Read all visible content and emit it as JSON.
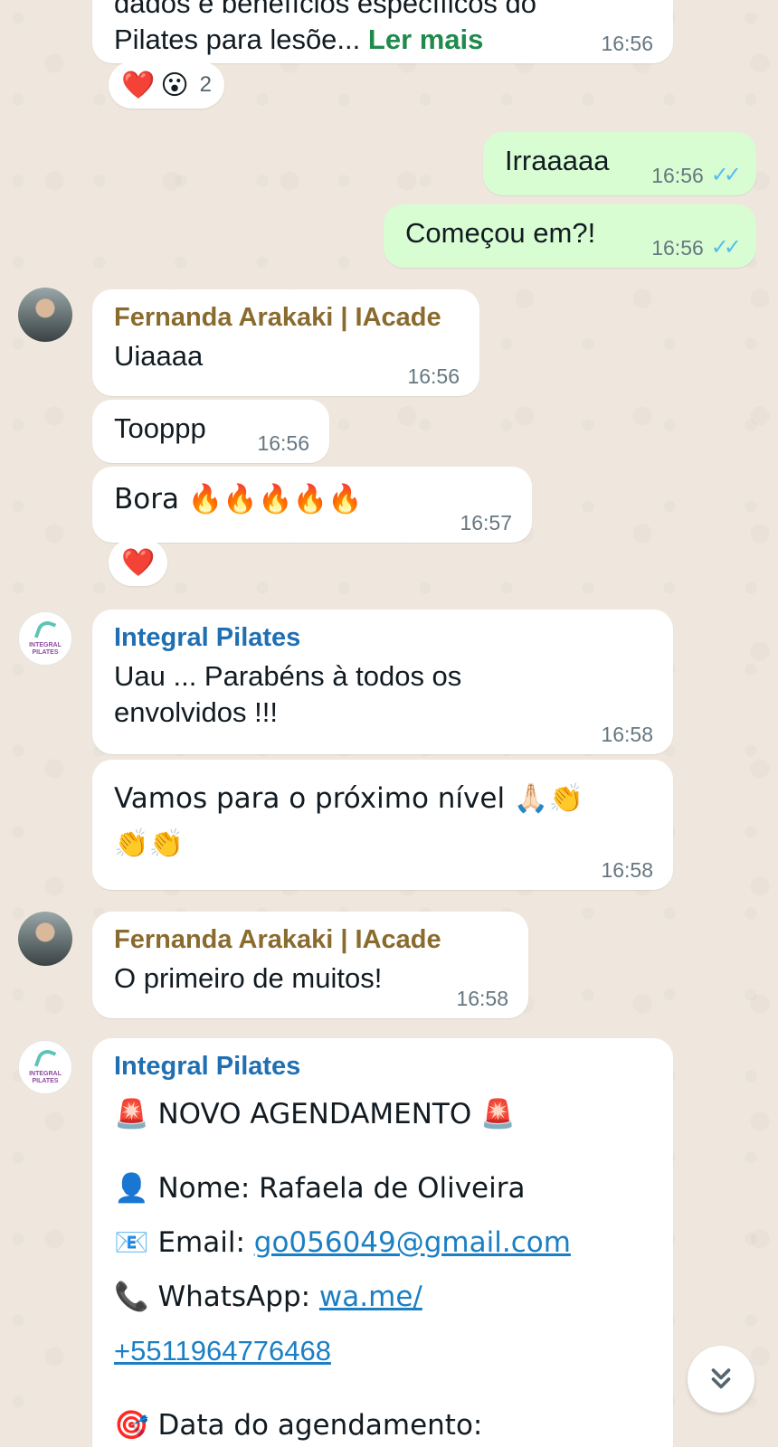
{
  "messages": {
    "m0": {
      "text_top": "dados e benefícios específicos do",
      "text_line": "Pilates para lesõe...",
      "read_more": "Ler mais",
      "time": "16:56",
      "reactions": {
        "items": [
          "❤️",
          "😮"
        ],
        "count": "2"
      }
    },
    "m1": {
      "text": "Irraaaaa",
      "time": "16:56"
    },
    "m2": {
      "text": "Começou em?!",
      "time": "16:56"
    },
    "m3": {
      "sender": "Fernanda Arakaki | IAcade",
      "text": "Uiaaaa",
      "time": "16:56"
    },
    "m4": {
      "text": "Tooppp",
      "time": "16:56"
    },
    "m5": {
      "text": "Bora 🔥🔥🔥🔥🔥",
      "time": "16:57",
      "reactions": {
        "items": [
          "❤️"
        ]
      }
    },
    "m6": {
      "sender": "Integral Pilates",
      "line1": "Uau ... Parabéns à todos os",
      "line2": "envolvidos !!!",
      "time": "16:58"
    },
    "m7": {
      "line1": "Vamos para o próximo nível 🙏🏻👏",
      "line2": "👏👏",
      "time": "16:58"
    },
    "m8": {
      "sender": "Fernanda Arakaki | IAcade",
      "text": "O primeiro de muitos!",
      "time": "16:58"
    },
    "m9": {
      "sender": "Integral Pilates",
      "title": "🚨 NOVO AGENDAMENTO 🚨",
      "name": "👤 Nome: Rafaela de Oliveira",
      "email_label": "📧 Email: ",
      "email_value": "go056049@gmail.com",
      "whatsapp_label": "📞 WhatsApp: ",
      "whatsapp_link_1": "wa.me/",
      "whatsapp_link_2": "+5511964776468",
      "date_line": "🎯 Data do agendamento:"
    }
  },
  "avatars": {
    "fernanda": "Fernanda Arakaki avatar",
    "integral_logo_text_1": "INTEGRAL",
    "integral_logo_text_2": "PILATES"
  },
  "icons": {
    "scroll_down": "double-chevron-down-icon",
    "read_ticks": "double-check-icon"
  },
  "colors": {
    "outgoing": "#d9fdd3",
    "incoming": "#ffffff",
    "tick_blue": "#53bdeb",
    "link": "#1b7fc4"
  }
}
